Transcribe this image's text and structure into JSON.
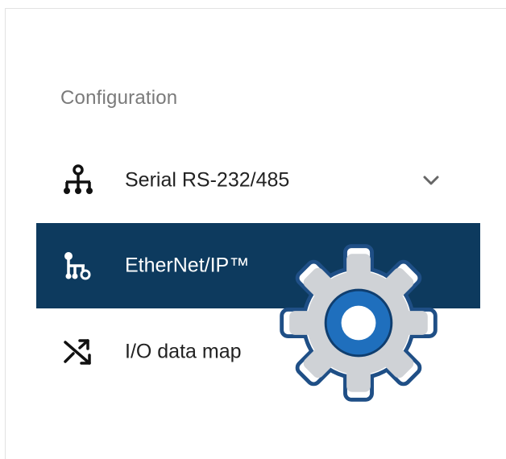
{
  "config": {
    "section_title": "Configuration",
    "items": [
      {
        "label": "Serial RS-232/485",
        "icon": "network-tree-icon",
        "expandable": true,
        "selected": false
      },
      {
        "label": "EtherNet/IP™",
        "icon": "ethernet-ip-icon",
        "expandable": false,
        "selected": true
      },
      {
        "label": "I/O data map",
        "icon": "shuffle-icon",
        "expandable": false,
        "selected": false
      }
    ]
  },
  "colors": {
    "selected_bg": "#0d3a5e",
    "section_title": "#7a7a7a",
    "label": "#222222",
    "gear_body": "#cfd2d6",
    "gear_ring": "#1f6fbd"
  },
  "overlay": {
    "icon": "settings-gear-icon"
  }
}
